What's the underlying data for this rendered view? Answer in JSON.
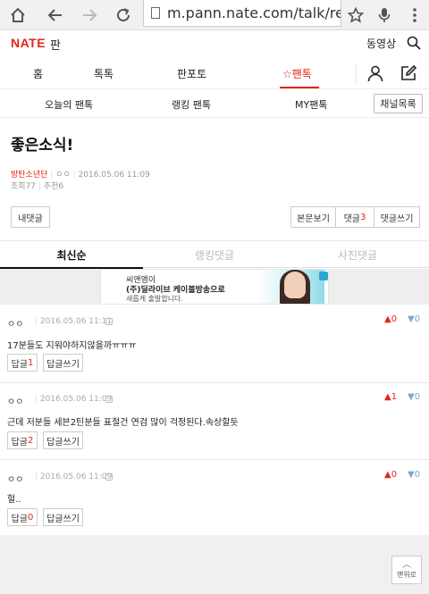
{
  "browser": {
    "url": "m.pann.nate.com/talk/reply"
  },
  "header": {
    "logo": "NATE",
    "logo_sub": "판",
    "video_link": "동영상"
  },
  "nav": {
    "items": [
      "홈",
      "톡톡",
      "판포토",
      "☆팬톡"
    ]
  },
  "sub_nav": {
    "items": [
      "오늘의 팬톡",
      "랭킹 팬톡",
      "MY팬톡"
    ],
    "channel_button": "채널목록"
  },
  "post": {
    "title": "좋은소식!",
    "category": "방탄소년단",
    "author": "ㅇㅇ",
    "date": "2016.05.06 11:09",
    "views_label": "조회",
    "views": "77",
    "recommend_label": "추천",
    "recommends": "6"
  },
  "actions": {
    "my_comments": "내댓글",
    "view_post": "본문보기",
    "comments_label": "댓글",
    "comments_count": "3",
    "write_comment": "댓글쓰기"
  },
  "tabs": [
    "최신순",
    "랭킹댓글",
    "사진댓글"
  ],
  "ad": {
    "line1": "씨앤앰이",
    "line2": "(주)딜라이브 케이블방송으로",
    "line3": "새롭게 출발합니다."
  },
  "comments": [
    {
      "user": "ㅇㅇ",
      "date": "2016.05.06 11:11",
      "body": "17분들도 지워야하지않을까ㅠㅠㅠ",
      "likes": "0",
      "dislikes": "0",
      "reply_label": "답글",
      "reply_count": "1",
      "write_reply": "답글쓰기"
    },
    {
      "user": "ㅇㅇ",
      "date": "2016.05.06 11:09",
      "body": "근데 저분들 세븐2틴분들 표절건 연검 많이 걱정된다.속상할듯",
      "likes": "1",
      "dislikes": "0",
      "reply_label": "답글",
      "reply_count": "2",
      "write_reply": "답글쓰기"
    },
    {
      "user": "ㅇㅇ",
      "date": "2016.05.06 11:09",
      "body": "헐..",
      "likes": "0",
      "dislikes": "0",
      "reply_label": "답글",
      "reply_count": "0",
      "write_reply": "답글쓰기"
    }
  ],
  "to_top": "맨위로",
  "colors": {
    "brand": "#e5231a",
    "dislike": "#7aa9d8"
  }
}
